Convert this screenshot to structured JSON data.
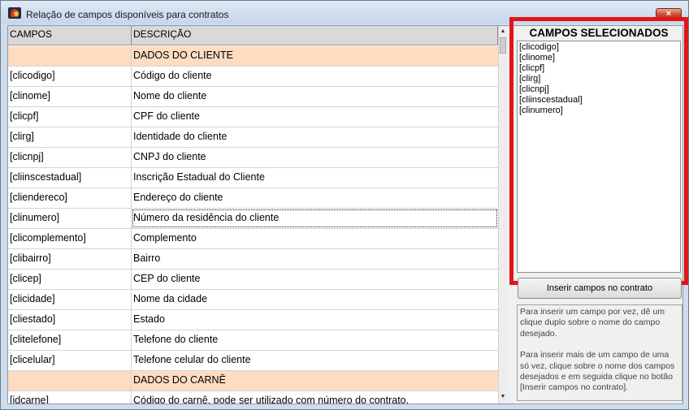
{
  "window": {
    "title": "Relação de campos disponíveis para contratos",
    "close_glyph": "×"
  },
  "grid": {
    "columns": [
      "CAMPOS",
      "DESCRIÇÃO"
    ],
    "rows": [
      {
        "campo": "",
        "descricao": "DADOS DO CLIENTE",
        "section": true
      },
      {
        "campo": "[clicodigo]",
        "descricao": "Código do cliente"
      },
      {
        "campo": "[clinome]",
        "descricao": "Nome do cliente"
      },
      {
        "campo": "[clicpf]",
        "descricao": "CPF do cliente"
      },
      {
        "campo": "[clirg]",
        "descricao": "Identidade do cliente"
      },
      {
        "campo": "[clicnpj]",
        "descricao": "CNPJ do cliente"
      },
      {
        "campo": "[cliinscestadual]",
        "descricao": "Inscrição Estadual do Cliente"
      },
      {
        "campo": "[cliendereco]",
        "descricao": "Endereço do cliente"
      },
      {
        "campo": "[clinumero]",
        "descricao": "Número da residência do cliente",
        "focused": true
      },
      {
        "campo": "[clicomplemento]",
        "descricao": "Complemento"
      },
      {
        "campo": "[clibairro]",
        "descricao": "Bairro"
      },
      {
        "campo": "[clicep]",
        "descricao": "CEP do cliente"
      },
      {
        "campo": "[clicidade]",
        "descricao": "Nome da cidade"
      },
      {
        "campo": "[cliestado]",
        "descricao": "Estado"
      },
      {
        "campo": "[clitelefone]",
        "descricao": "Telefone do cliente"
      },
      {
        "campo": "[clicelular]",
        "descricao": "Telefone celular do cliente"
      },
      {
        "campo": "",
        "descricao": "DADOS DO CARNÊ",
        "section": true
      },
      {
        "campo": "[idcarne]",
        "descricao": "Código do carnê, pode ser utilizado com número do contrato."
      }
    ]
  },
  "selected": {
    "title": "CAMPOS SELECIONADOS",
    "items": [
      "[clicodigo]",
      "[clinome]",
      "[clicpf]",
      "[clirg]",
      "[clicnpj]",
      "[cliinscestadual]",
      "[clinumero]"
    ]
  },
  "insert_button": {
    "label": "Inserir campos no contrato"
  },
  "help": {
    "paragraph1": "Para inserir um campo por vez, dê um clique duplo sobre o nome do campo desejado.",
    "paragraph2": "Para inserir mais de um campo de uma só vez, clique sobre o nome dos campos desejados e em seguida clique no botão [Inserir campos no contrato]."
  },
  "colors": {
    "section_row": "#fddcc2",
    "highlight_border": "#e3141a",
    "title_bar": "#c6d6ea"
  },
  "icons": [
    "app-icon",
    "close-icon",
    "scroll-up-icon",
    "scroll-down-icon"
  ]
}
